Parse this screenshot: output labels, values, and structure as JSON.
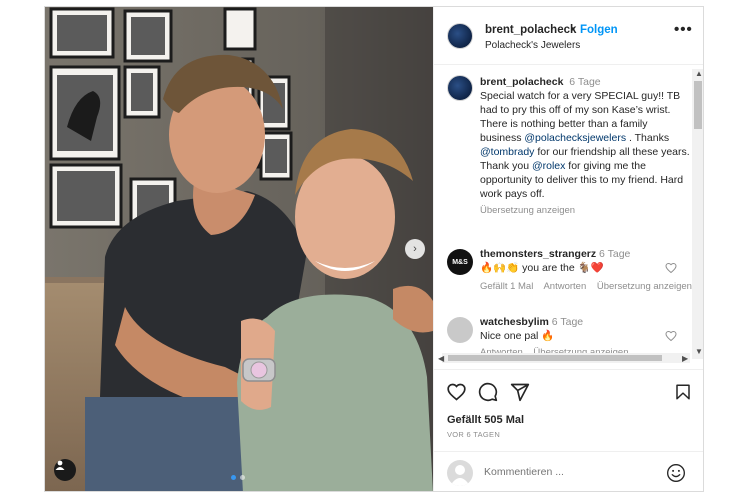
{
  "post": {
    "header": {
      "username": "brent_polacheck",
      "separator": "•",
      "follow_label": "Folgen",
      "location": "Polacheck's Jewelers",
      "more_icon": "•••"
    },
    "caption": {
      "username": "brent_polacheck",
      "time": "6 Tage",
      "text_part1": "Special watch for a very SPECIAL guy!! TB had to pry this off of my son Kase’s wrist. There is nothing better than a family business ",
      "mention1": "@polachecksjewelers",
      "text_part2": " . Thanks ",
      "mention2": "@tombrady",
      "text_part3": " for our friendship all these years. Thank you ",
      "mention3": "@rolex",
      "text_part4": " for giving me the opportunity to deliver this to my friend. Hard work pays off.",
      "translate_label": "Übersetzung anzeigen"
    },
    "comments": [
      {
        "username": "themonsters_strangerz",
        "time": "6 Tage",
        "avatar_text": "M&S",
        "text": "🔥🙌👏 you are the 🐐❤️",
        "likes_label": "Gefällt 1 Mal",
        "reply_label": "Antworten",
        "translate_label": "Übersetzung anzeigen"
      },
      {
        "username": "watchesbylim",
        "time": "6 Tage",
        "text": "Nice one pal 🔥",
        "reply_label": "Antworten",
        "translate_label": "Übersetzung anzeigen"
      }
    ],
    "likes": "Gefällt 505 Mal",
    "date": "VOR 6 TAGEN",
    "composer_placeholder": "Kommentieren ...",
    "carousel": {
      "total": 2,
      "active": 0
    }
  },
  "colors": {
    "link_blue": "#0095f6",
    "mention_blue": "#00376b",
    "muted": "#8e8e8e",
    "border": "#dbdbdb",
    "like_red": "#ed4956"
  },
  "icons": [
    "carousel-next-icon",
    "tagged-user-icon",
    "more-options-icon",
    "heart-icon",
    "comment-icon",
    "share-icon",
    "bookmark-icon",
    "emoji-icon"
  ]
}
